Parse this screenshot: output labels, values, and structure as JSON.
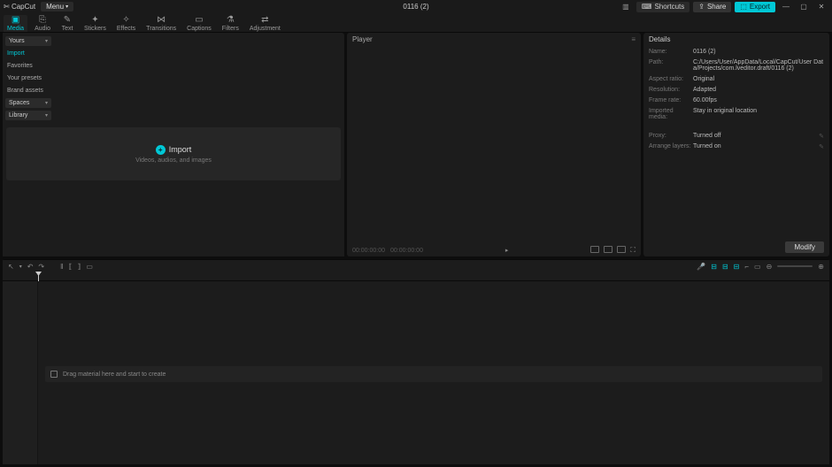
{
  "titlebar": {
    "app": "CapCut",
    "menu": "Menu",
    "title": "0116 (2)",
    "shortcuts": "Shortcuts",
    "share": "Share",
    "export": "Export"
  },
  "top_tabs": [
    {
      "icon": "▣",
      "label": "Media",
      "active": true
    },
    {
      "icon": "⎘",
      "label": "Audio"
    },
    {
      "icon": "✎",
      "label": "Text"
    },
    {
      "icon": "✦",
      "label": "Stickers"
    },
    {
      "icon": "✧",
      "label": "Effects"
    },
    {
      "icon": "⋈",
      "label": "Transitions"
    },
    {
      "icon": "▭",
      "label": "Captions"
    },
    {
      "icon": "⚗",
      "label": "Filters"
    },
    {
      "icon": "⇄",
      "label": "Adjustment"
    }
  ],
  "media": {
    "sidebar": {
      "yours": "Yours",
      "items": [
        "Import",
        "Favorites",
        "Your presets",
        "Brand assets"
      ],
      "spaces": "Spaces",
      "library": "Library"
    },
    "import": {
      "label": "Import",
      "sub": "Videos, audios, and images"
    }
  },
  "player": {
    "title": "Player",
    "time_cur": "00:00:00:00",
    "time_total": "00:00:00:00"
  },
  "details": {
    "title": "Details",
    "rows": [
      {
        "label": "Name:",
        "value": "0116 (2)"
      },
      {
        "label": "Path:",
        "value": "C:/Users/User/AppData/Local/CapCut/User Data/Projects/com.lveditor.draft/0116 (2)"
      },
      {
        "label": "Aspect ratio:",
        "value": "Original"
      },
      {
        "label": "Resolution:",
        "value": "Adapted"
      },
      {
        "label": "Frame rate:",
        "value": "60.00fps"
      },
      {
        "label": "Imported media:",
        "value": "Stay in original location"
      },
      {
        "label": "Proxy:",
        "value": "Turned off",
        "edit": true
      },
      {
        "label": "Arrange layers:",
        "value": "Turned on",
        "edit": true
      }
    ],
    "modify": "Modify"
  },
  "timeline": {
    "drop": "Drag material here and start to create"
  }
}
